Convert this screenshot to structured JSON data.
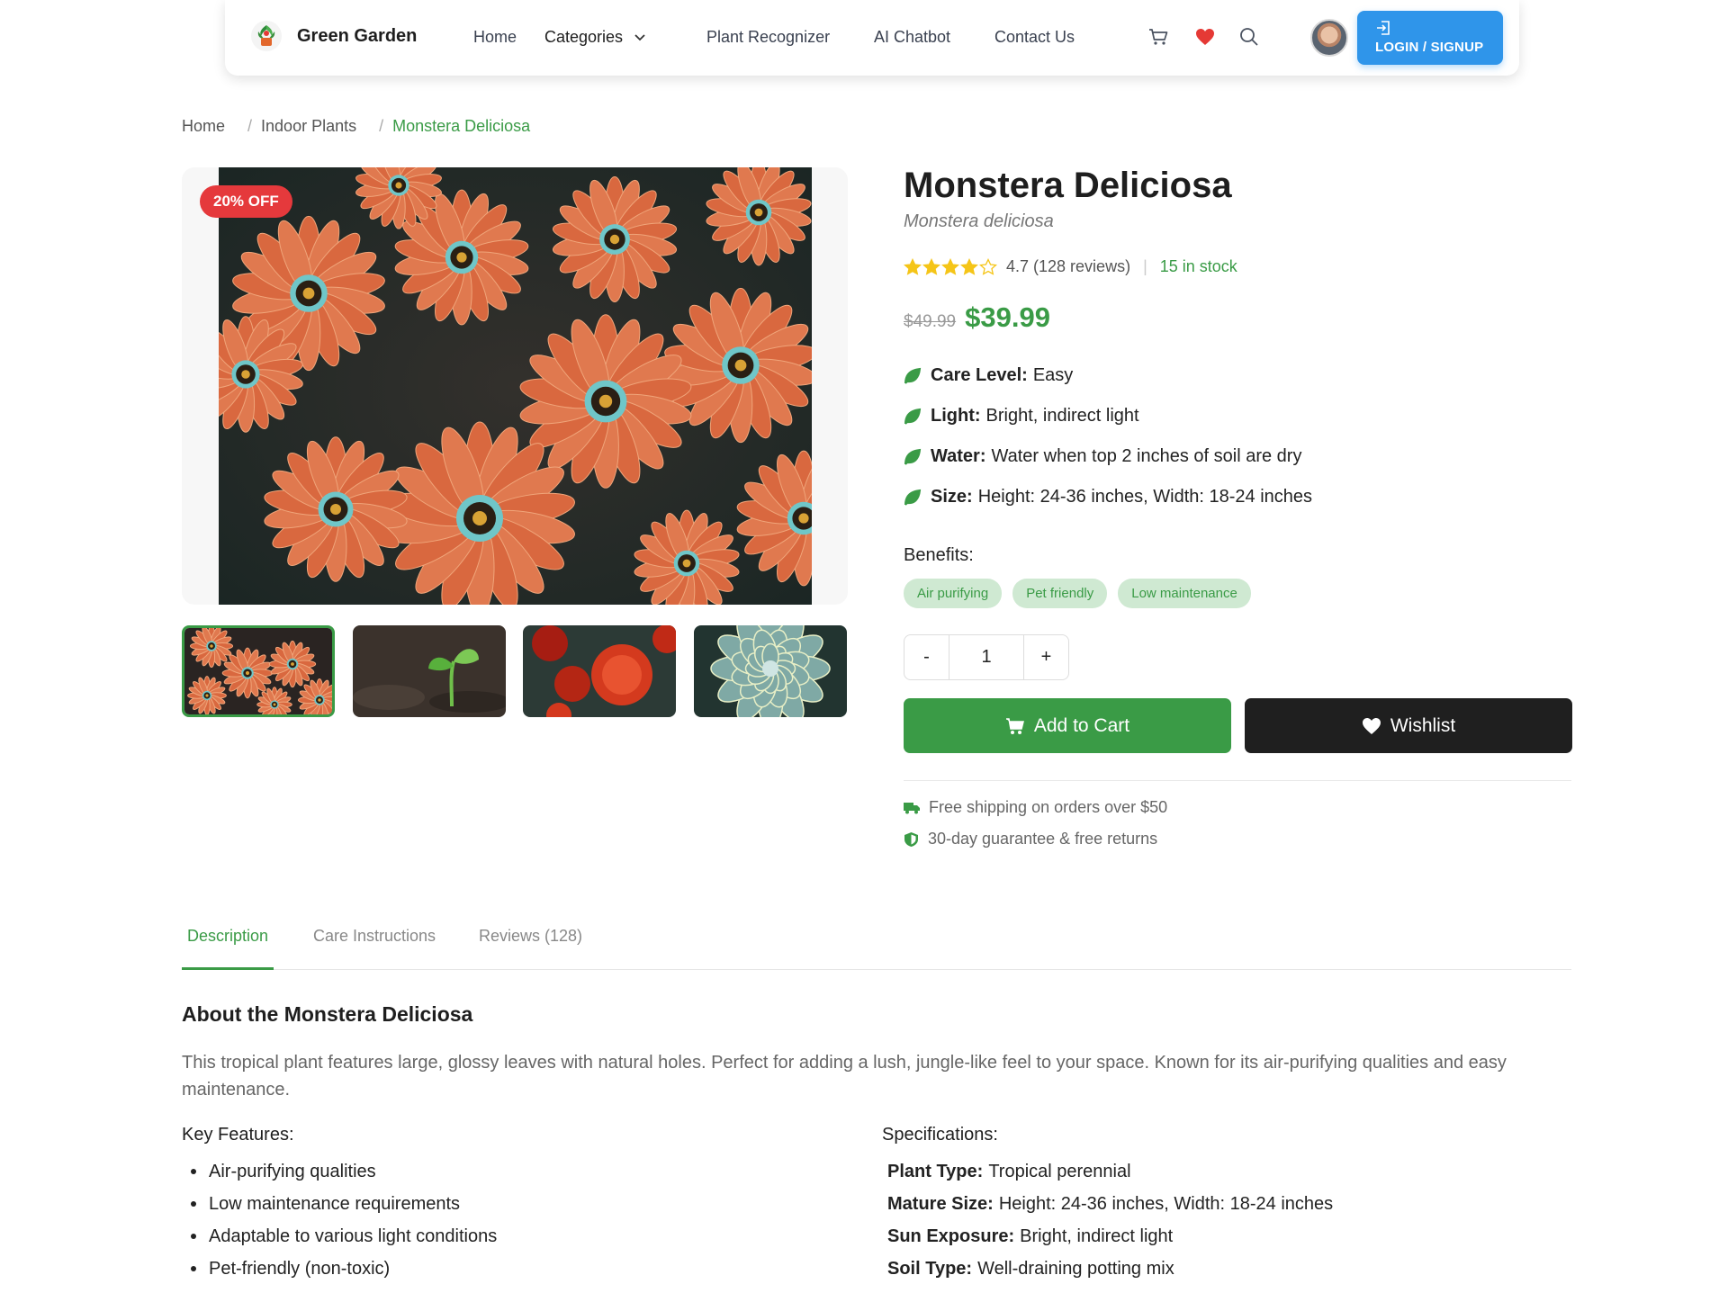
{
  "nav": {
    "brand": "Green Garden",
    "links": [
      "Home",
      "Categories",
      "Plant Recognizer",
      "AI Chatbot",
      "Contact Us"
    ],
    "login": "LOGIN / SIGNUP"
  },
  "breadcrumb": [
    "Home",
    "Indoor Plants",
    "Monstera Deliciosa"
  ],
  "gallery": {
    "badge": "20% OFF",
    "thumbnails": [
      "orange daisies",
      "seedling",
      "red carnations",
      "succulent"
    ],
    "selected_index": 0
  },
  "product": {
    "title": "Monstera Deliciosa",
    "scientific_name": "Monstera deliciosa",
    "rating": 4.7,
    "rating_text": "4.7 (128 reviews)",
    "stock": "15 in stock",
    "old_price": "$49.99",
    "price": "$39.99",
    "attributes": [
      {
        "label": "Care Level:",
        "value": "Easy"
      },
      {
        "label": "Light:",
        "value": "Bright, indirect light"
      },
      {
        "label": "Water:",
        "value": "Water when top 2 inches of soil are dry"
      },
      {
        "label": "Size:",
        "value": "Height: 24-36 inches, Width: 18-24 inches"
      }
    ],
    "benefits_label": "Benefits:",
    "benefits": [
      "Air purifying",
      "Pet friendly",
      "Low maintenance"
    ],
    "quantity": {
      "minus": "-",
      "value": "1",
      "plus": "+"
    },
    "add_to_cart": "Add to Cart",
    "wishlist": "Wishlist",
    "shipping": "Free shipping on orders over $50",
    "guarantee": "30-day guarantee & free returns"
  },
  "tabs": [
    "Description",
    "Care Instructions",
    "Reviews (128)"
  ],
  "description": {
    "title": "About the Monstera Deliciosa",
    "text": "This tropical plant features large, glossy leaves with natural holes. Perfect for adding a lush, jungle-like feel to your space. Known for its air-purifying qualities and easy maintenance.",
    "features_title": "Key Features:",
    "features": [
      "Air-purifying qualities",
      "Low maintenance requirements",
      "Adaptable to various light conditions",
      "Pet-friendly (non-toxic)"
    ],
    "specs_title": "Specifications:",
    "specs": [
      {
        "label": "Plant Type:",
        "value": "Tropical perennial"
      },
      {
        "label": "Mature Size:",
        "value": "Height: 24-36 inches, Width: 18-24 inches"
      },
      {
        "label": "Sun Exposure:",
        "value": "Bright, indirect light"
      },
      {
        "label": "Soil Type:",
        "value": "Well-draining potting mix"
      }
    ]
  },
  "colors": {
    "accent_green": "#3a9b46",
    "login_blue": "#2f95ea",
    "badge_red": "#e5393c",
    "heart_red": "#e53935",
    "wishlist_dark": "#1f1f1f"
  },
  "icons": [
    "cart-icon",
    "heart-icon",
    "search-icon",
    "login-icon",
    "leaf-icon",
    "truck-icon",
    "shield-icon",
    "star-icon",
    "chevron-down-icon"
  ]
}
